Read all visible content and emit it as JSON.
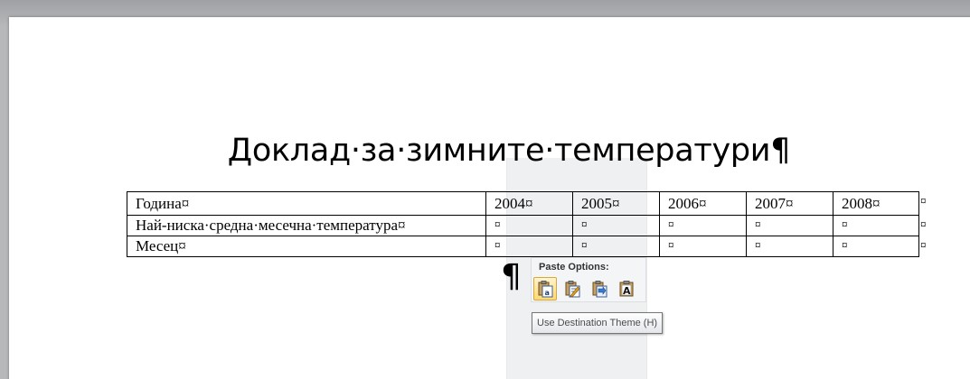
{
  "document": {
    "title": "Доклад·за·зимните·температури¶",
    "table": {
      "rows": [
        {
          "label": "Година¤",
          "cells": [
            "2004¤",
            "2005¤",
            "2006¤",
            "2007¤",
            "2008¤"
          ]
        },
        {
          "label": "Най-ниска·средна·месечна·температура¤",
          "cells": [
            "¤",
            "¤",
            "¤",
            "¤",
            "¤"
          ]
        },
        {
          "label": "Месец¤",
          "cells": [
            "¤",
            "¤",
            "¤",
            "¤",
            "¤"
          ]
        }
      ],
      "row_end_mark": "¤"
    },
    "paragraph_mark": "¶"
  },
  "paste_options": {
    "title": "Paste Options:",
    "buttons": [
      {
        "name": "use-destination-theme",
        "icon": "paste-destination-theme-icon",
        "active": true
      },
      {
        "name": "merge-formatting",
        "icon": "paste-merge-formatting-icon",
        "active": false
      },
      {
        "name": "picture",
        "icon": "paste-picture-icon",
        "active": false
      },
      {
        "name": "keep-text-only",
        "icon": "paste-keep-text-only-icon",
        "active": false
      }
    ],
    "tooltip": "Use Destination Theme (H)"
  },
  "colors": {
    "active_button_fill": "#ffd971",
    "active_button_border": "#d7a83f",
    "panel_bg": "#f4f5f6"
  }
}
